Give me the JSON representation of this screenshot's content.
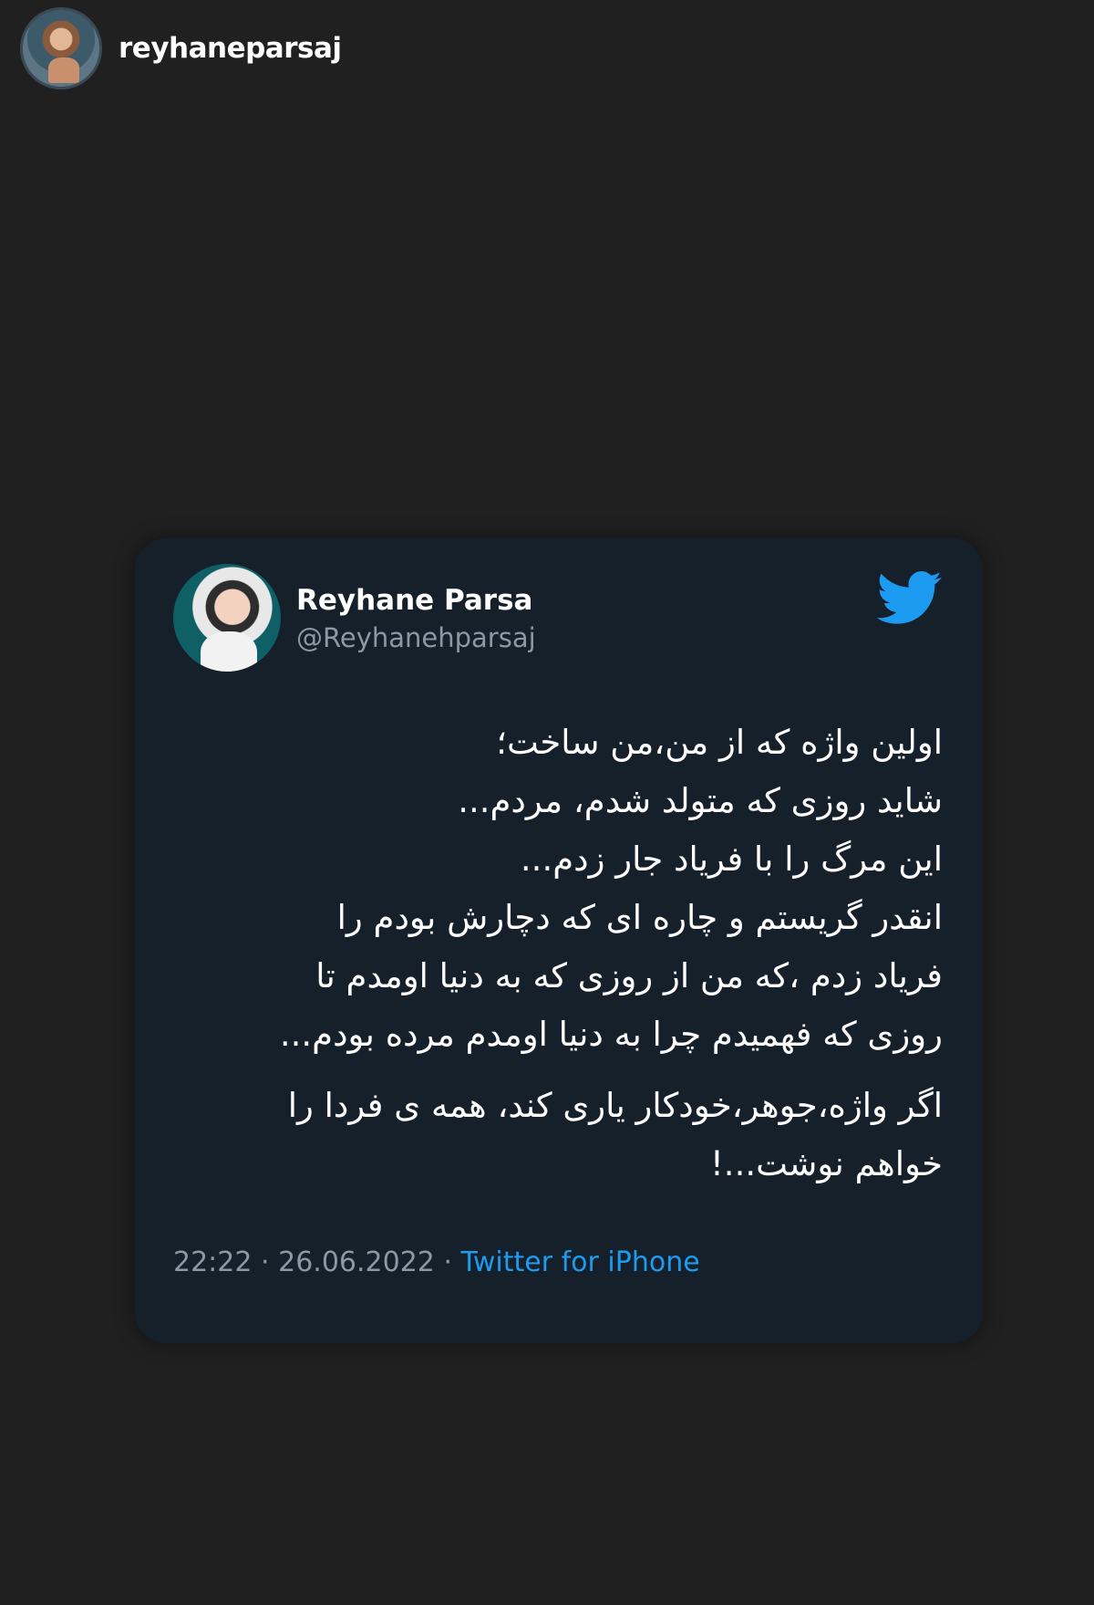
{
  "story": {
    "username": "reyhaneparsaj"
  },
  "tweet": {
    "author_name": "Reyhane Parsa",
    "author_handle": "@Reyhanehparsaj",
    "lines": [
      "اولین واژه که از من،من ساخت؛",
      "شاید روزی که متولد شدم، مردم...",
      "این مرگ را با فریاد جار زدم...",
      "انقدر گریستم و چاره ای که دچارش بودم را",
      "فریاد زدم ،که من از روزی که به دنیا اومدم تا",
      "روزی که فهمیدم چرا به دنیا اومدم مرده بودم..."
    ],
    "lines2": [
      "اگر واژه،جوهر،خودکار یاری کند، همه ی فردا را",
      "خواهم نوشت...!"
    ],
    "time": "22:22",
    "separator": "·",
    "date": "26.06.2022",
    "source": "Twitter for iPhone"
  },
  "colors": {
    "page_background": "#202021",
    "card_background": "#15202b",
    "secondary_text": "#8b98a5",
    "twitter_blue": "#1d9bf0"
  },
  "icons": {
    "brand": "twitter-bird-icon"
  }
}
